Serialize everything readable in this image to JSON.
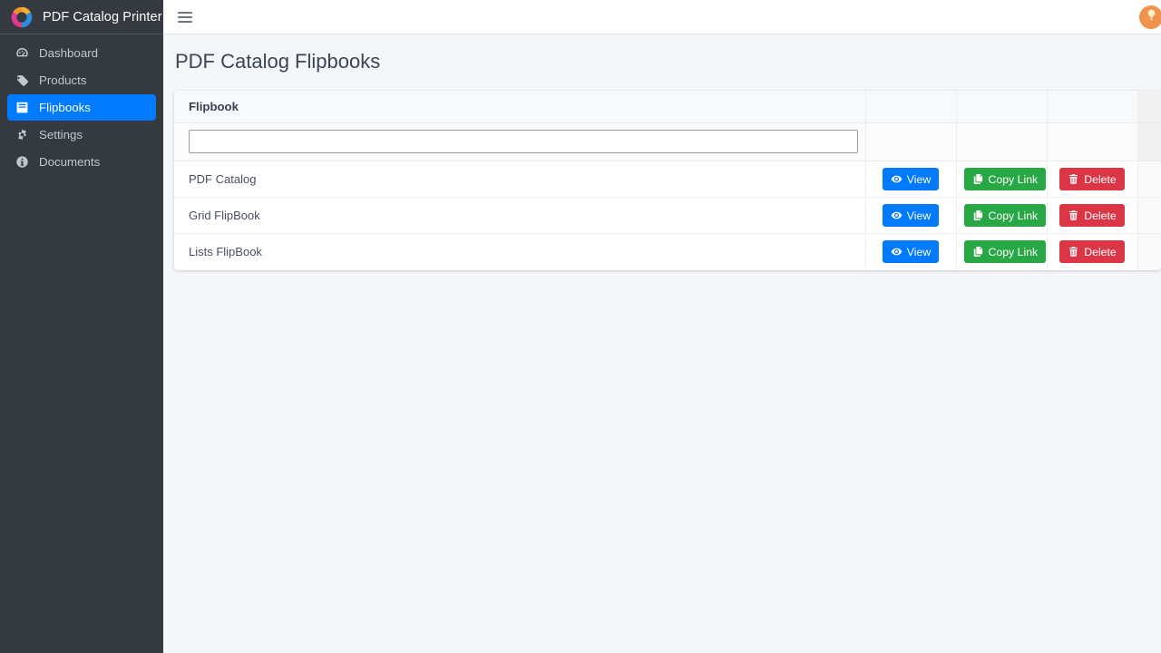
{
  "brand": {
    "title": "PDF Catalog Printer",
    "logo_icon": "tri-swirl-logo",
    "colors": {
      "logo_yellow": "#f0a92a",
      "logo_pink": "#e0399a",
      "logo_blue": "#2b8fe0"
    }
  },
  "sidebar": {
    "background": "#343a40",
    "active_color": "#007bff",
    "items": [
      {
        "label": "Dashboard",
        "icon": "tachometer-icon",
        "active": false
      },
      {
        "label": "Products",
        "icon": "tag-icon",
        "active": false
      },
      {
        "label": "Flipbooks",
        "icon": "book-icon",
        "active": true
      },
      {
        "label": "Settings",
        "icon": "gear-icon",
        "active": false
      },
      {
        "label": "Documents",
        "icon": "info-circle-icon",
        "active": false
      }
    ]
  },
  "topbar": {
    "menu_icon": "hamburger-icon",
    "avatar_icon": "lightbulb-icon",
    "avatar_color": "#f0934e"
  },
  "page": {
    "title": "PDF Catalog Flipbooks"
  },
  "table": {
    "columns": [
      "Flipbook",
      "",
      "",
      ""
    ],
    "filter": {
      "value": "",
      "placeholder": ""
    },
    "rows": [
      {
        "name": "PDF Catalog",
        "view_label": "View",
        "copy_label": "Copy Link",
        "delete_label": "Delete"
      },
      {
        "name": "Grid FlipBook",
        "view_label": "View",
        "copy_label": "Copy Link",
        "delete_label": "Delete"
      },
      {
        "name": "Lists FlipBook",
        "view_label": "View",
        "copy_label": "Copy Link",
        "delete_label": "Delete"
      }
    ],
    "button_colors": {
      "view": "#007bff",
      "copy": "#28a745",
      "delete": "#dc3545"
    },
    "icons": {
      "view": "eye-icon",
      "copy": "copy-icon",
      "delete": "trash-icon"
    }
  }
}
